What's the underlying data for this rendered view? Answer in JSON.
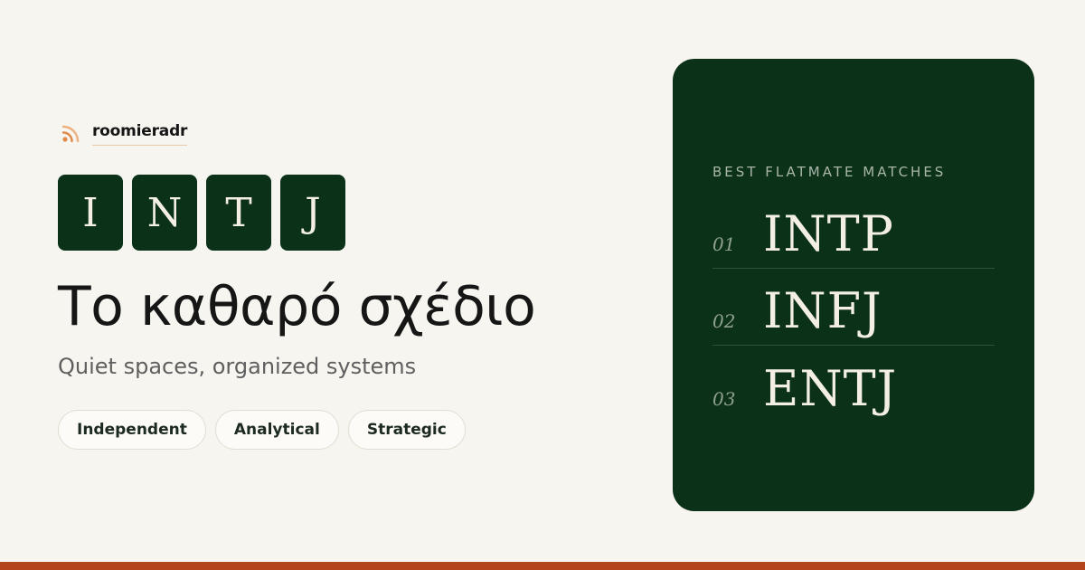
{
  "brand": {
    "name": "roomieradr",
    "icon": "rss-signal-icon",
    "icon_color": "#E08A4A"
  },
  "personality": {
    "letters": [
      "I",
      "N",
      "T",
      "J"
    ]
  },
  "headline": "Το καθαρό σχέδιο",
  "subtitle": "Quiet spaces, organized systems",
  "traits": [
    "Independent",
    "Analytical",
    "Strategic"
  ],
  "matches": {
    "heading": "BEST FLATMATE MATCHES",
    "items": [
      {
        "rank": "01",
        "type": "INTP"
      },
      {
        "rank": "02",
        "type": "INFJ"
      },
      {
        "rank": "03",
        "type": "ENTJ"
      }
    ]
  },
  "colors": {
    "background": "#F7F5F0",
    "dark_green": "#0C3119",
    "accent_orange": "#B2451C",
    "tile_text": "#F3EFE6"
  }
}
